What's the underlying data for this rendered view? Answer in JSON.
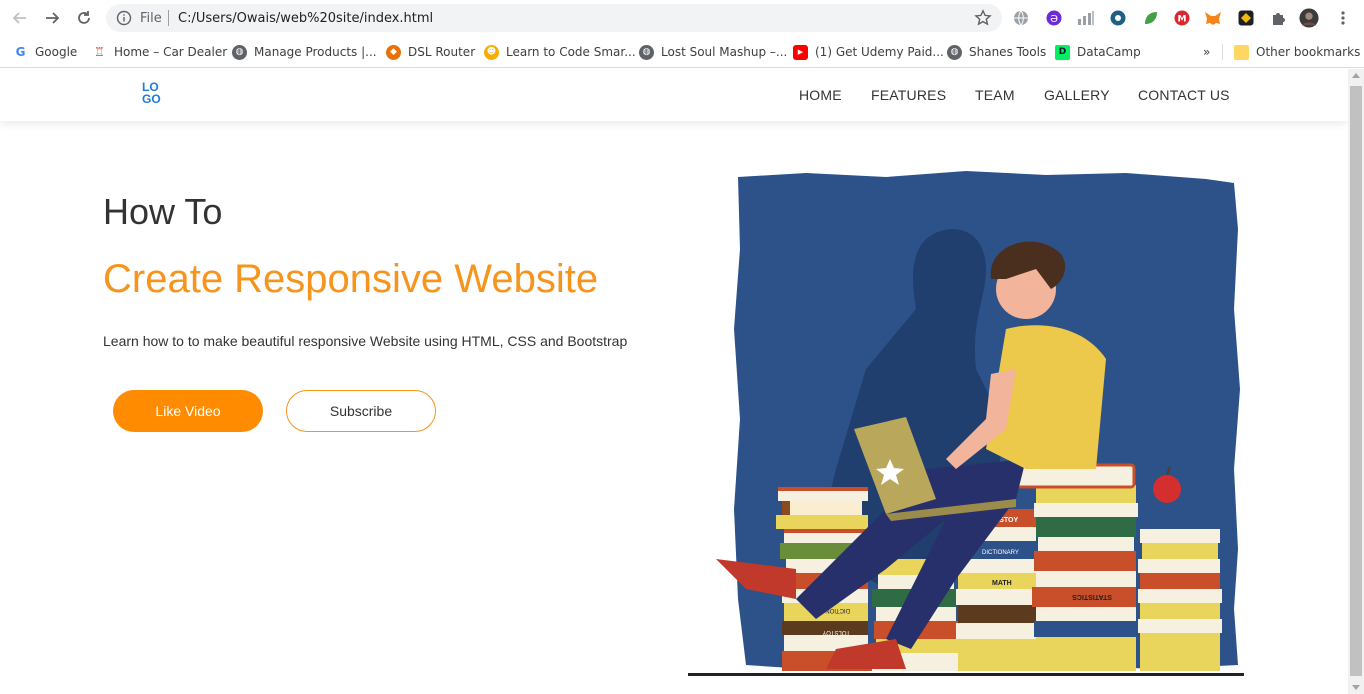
{
  "browser": {
    "omnibox": {
      "scheme_label": "File",
      "url": "C:/Users/Owais/web%20site/index.html"
    },
    "bookmarks": [
      {
        "label": "Google",
        "icon": "google-icon",
        "color": "#4285f4"
      },
      {
        "label": "Home – Car Dealer",
        "icon": "car-dealer-icon",
        "color": "#d93025"
      },
      {
        "label": "Manage Products |...",
        "icon": "globe-icon",
        "color": "#5f6368"
      },
      {
        "label": "DSL Router",
        "icon": "router-icon",
        "color": "#e8710a"
      },
      {
        "label": "Learn to Code Smar...",
        "icon": "code-avatar-icon",
        "color": "#f9ab00"
      },
      {
        "label": "Lost Soul Mashup –...",
        "icon": "globe-icon",
        "color": "#5f6368"
      },
      {
        "label": "(1) Get Udemy Paid...",
        "icon": "youtube-icon",
        "color": "#ff0000"
      },
      {
        "label": "Shanes Tools",
        "icon": "globe-icon",
        "color": "#5f6368"
      },
      {
        "label": "DataCamp",
        "icon": "datacamp-icon",
        "color": "#03ef62"
      }
    ],
    "overflow_label": "»",
    "other_bookmarks": "Other bookmarks"
  },
  "site": {
    "logo_top": "LO",
    "logo_bottom": "GO",
    "nav": [
      "HOME",
      "FEATURES",
      "TEAM",
      "GALLERY",
      "CONTACT US"
    ],
    "hero": {
      "small_title": "How To",
      "big_title": "Create Responsive Website",
      "description": "Learn how to to make beautiful responsive Website using HTML, CSS and Bootstrap",
      "primary_button": "Like Video",
      "secondary_button": "Subscribe"
    },
    "illustration": {
      "book_labels": [
        "LEO TOLSTOY",
        "DICTIONARY",
        "MATH",
        "STATISTICS",
        "DICTIONARY",
        "TOLSTOY"
      ]
    }
  },
  "colors": {
    "accent": "#f7941d",
    "button": "#ff8c00",
    "logo": "#1d7bdd",
    "illustration_bg": "#2c5289"
  }
}
